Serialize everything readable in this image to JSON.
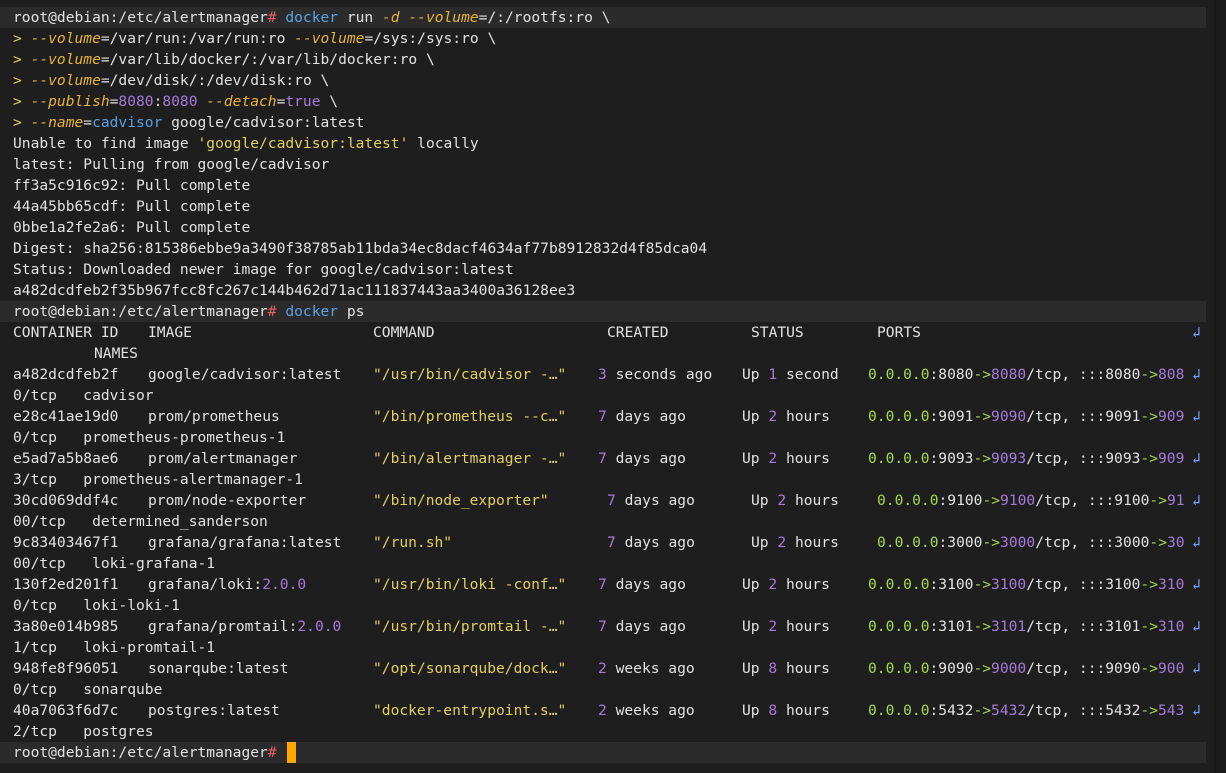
{
  "terminal": {
    "lines": [
      {
        "prompt": true,
        "segs": [
          [
            "root@debian:/etc/alertmanager",
            "white"
          ],
          [
            "# ",
            "red"
          ],
          [
            "docker",
            "cmd"
          ],
          [
            " run ",
            "white"
          ],
          [
            "-d",
            "param"
          ],
          [
            " ",
            "white"
          ],
          [
            "--volume",
            "param"
          ],
          [
            "=/:/rootfs:ro \\",
            "white"
          ]
        ]
      },
      {
        "segs": [
          [
            "> ",
            "cont"
          ],
          [
            "--volume",
            "param"
          ],
          [
            "=/var/run:/var/run:ro ",
            "white"
          ],
          [
            "--volume",
            "param"
          ],
          [
            "=/sys:/sys:ro \\",
            "white"
          ]
        ]
      },
      {
        "segs": [
          [
            "> ",
            "cont"
          ],
          [
            "--volume",
            "param"
          ],
          [
            "=/var/lib/docker/:/var/lib/docker:ro \\",
            "white"
          ]
        ]
      },
      {
        "segs": [
          [
            "> ",
            "cont"
          ],
          [
            "--volume",
            "param"
          ],
          [
            "=/dev/disk/:/dev/disk:ro \\",
            "white"
          ]
        ]
      },
      {
        "segs": [
          [
            "> ",
            "cont"
          ],
          [
            "--publish",
            "param"
          ],
          [
            "=",
            "white"
          ],
          [
            "8080",
            "num"
          ],
          [
            ":",
            "white"
          ],
          [
            "8080",
            "num"
          ],
          [
            " ",
            "white"
          ],
          [
            "--detach",
            "param"
          ],
          [
            "=",
            "white"
          ],
          [
            "true",
            "bool"
          ],
          [
            " \\",
            "white"
          ]
        ]
      },
      {
        "segs": [
          [
            "> ",
            "cont"
          ],
          [
            "--name",
            "param"
          ],
          [
            "=",
            "white"
          ],
          [
            "cadvisor",
            "cmd"
          ],
          [
            " google/cadvisor:latest",
            "white"
          ]
        ]
      },
      {
        "segs": [
          [
            "Unable to find image ",
            "white"
          ],
          [
            "'google/cadvisor:latest'",
            "str"
          ],
          [
            " locally",
            "white"
          ]
        ]
      },
      {
        "segs": [
          [
            "latest: Pulling from google/cadvisor",
            "white"
          ]
        ]
      },
      {
        "segs": [
          [
            "ff3a5c916c92: Pull complete",
            "white"
          ]
        ]
      },
      {
        "segs": [
          [
            "44a45bb65cdf: Pull complete",
            "white"
          ]
        ]
      },
      {
        "segs": [
          [
            "0bbe1a2fe2a6: Pull complete",
            "white"
          ]
        ]
      },
      {
        "segs": [
          [
            "Digest: sha256:815386ebbe9a3490f38785ab11bda34ec8dacf4634af77b8912832d4f85dca04",
            "white"
          ]
        ]
      },
      {
        "segs": [
          [
            "Status: Downloaded newer image for google/cadvisor:latest",
            "white"
          ]
        ]
      },
      {
        "segs": [
          [
            "a482dcdfeb2f35b967fcc8fc267c144b462d71ac111837443aa3400a36128ee3",
            "white"
          ]
        ]
      },
      {
        "prompt": true,
        "segs": [
          [
            "root@debian:/etc/alertmanager",
            "white"
          ],
          [
            "# ",
            "red"
          ],
          [
            "docker",
            "cmd"
          ],
          [
            " ps",
            "white"
          ]
        ]
      },
      {
        "cols": [
          [
            "CONTAINER ID",
            13,
            "white"
          ],
          [
            "IMAGE",
            148,
            "white"
          ],
          [
            "COMMAND",
            373,
            "white"
          ],
          [
            "CREATED",
            607,
            "white"
          ],
          [
            "STATUS",
            751,
            "white"
          ],
          [
            "PORTS",
            877,
            "white"
          ],
          [
            "↲",
            1192,
            "wrap"
          ]
        ]
      },
      {
        "cols": [
          [
            "NAMES",
            94,
            "white"
          ]
        ]
      },
      {
        "cols": [
          [
            "a482dcdfeb2f",
            13,
            "white"
          ],
          [
            "google/cadvisor:latest",
            148,
            "white"
          ],
          [
            "\"/usr/bin/cadvisor -…\"",
            373,
            "str"
          ],
          [
            "3 seconds ago",
            598,
            "white"
          ],
          [
            "Up 1 second",
            742,
            "white"
          ],
          [
            "0.0.0.0:8080->8080/tcp, :::8080->808",
            868,
            "green"
          ],
          [
            "↲",
            1192,
            "wrap"
          ]
        ]
      },
      {
        "cols": [
          [
            "0/tcp   cadvisor",
            13,
            "white"
          ]
        ]
      },
      {
        "cols": [
          [
            "e28c41ae19d0",
            13,
            "white"
          ],
          [
            "prom/prometheus",
            148,
            "white"
          ],
          [
            "\"/bin/prometheus --c…\"",
            373,
            "str"
          ],
          [
            "7 days ago",
            598,
            "white"
          ],
          [
            "Up 2 hours",
            742,
            "white"
          ],
          [
            "0.0.0.0:9091->9090/tcp, :::9091->909",
            868,
            "green"
          ],
          [
            "↲",
            1192,
            "wrap"
          ]
        ]
      },
      {
        "cols": [
          [
            "0/tcp   prometheus-prometheus-1",
            13,
            "white"
          ]
        ]
      },
      {
        "cols": [
          [
            "e5ad7a5b8ae6",
            13,
            "white"
          ],
          [
            "prom/alertmanager",
            148,
            "white"
          ],
          [
            "\"/bin/alertmanager -…\"",
            373,
            "str"
          ],
          [
            "7 days ago",
            598,
            "white"
          ],
          [
            "Up 2 hours",
            742,
            "white"
          ],
          [
            "0.0.0.0:9093->9093/tcp, :::9093->909",
            868,
            "green"
          ],
          [
            "↲",
            1192,
            "wrap"
          ]
        ]
      },
      {
        "cols": [
          [
            "3/tcp   prometheus-alertmanager-1",
            13,
            "white"
          ]
        ]
      },
      {
        "cols": [
          [
            "30cd069ddf4c",
            13,
            "white"
          ],
          [
            "prom/node-exporter",
            148,
            "white"
          ],
          [
            "\"/bin/node_exporter\"",
            373,
            "str"
          ],
          [
            "7 days ago",
            607,
            "white"
          ],
          [
            "Up 2 hours",
            751,
            "white"
          ],
          [
            "0.0.0.0:9100->9100/tcp, :::9100->91",
            877,
            "green"
          ],
          [
            "↲",
            1192,
            "wrap"
          ]
        ]
      },
      {
        "cols": [
          [
            "00/tcp   determined_sanderson",
            13,
            "white"
          ]
        ]
      },
      {
        "cols": [
          [
            "9c83403467f1",
            13,
            "white"
          ],
          [
            "grafana/grafana:latest",
            148,
            "white"
          ],
          [
            "\"/run.sh\"",
            373,
            "str"
          ],
          [
            "7 days ago",
            607,
            "white"
          ],
          [
            "Up 2 hours",
            751,
            "white"
          ],
          [
            "0.0.0.0:3000->3000/tcp, :::3000->30",
            877,
            "green"
          ],
          [
            "↲",
            1192,
            "wrap"
          ]
        ]
      },
      {
        "cols": [
          [
            "00/tcp   loki-grafana-1",
            13,
            "white"
          ]
        ]
      },
      {
        "cols": [
          [
            "130f2ed201f1",
            13,
            "white"
          ],
          [
            "grafana/loki:2.0.0",
            148,
            "white"
          ],
          [
            "\"/usr/bin/loki -conf…\"",
            373,
            "str"
          ],
          [
            "7 days ago",
            598,
            "white"
          ],
          [
            "Up 2 hours",
            742,
            "white"
          ],
          [
            "0.0.0.0:3100->3100/tcp, :::3100->310",
            868,
            "green"
          ],
          [
            "↲",
            1192,
            "wrap"
          ]
        ]
      },
      {
        "cols": [
          [
            "0/tcp   loki-loki-1",
            13,
            "white"
          ]
        ]
      },
      {
        "cols": [
          [
            "3a80e014b985",
            13,
            "white"
          ],
          [
            "grafana/promtail:2.0.0",
            148,
            "white"
          ],
          [
            "\"/usr/bin/promtail -…\"",
            373,
            "str"
          ],
          [
            "7 days ago",
            598,
            "white"
          ],
          [
            "Up 2 hours",
            742,
            "white"
          ],
          [
            "0.0.0.0:3101->3101/tcp, :::3101->310",
            868,
            "green"
          ],
          [
            "↲",
            1192,
            "wrap"
          ]
        ]
      },
      {
        "cols": [
          [
            "1/tcp   loki-promtail-1",
            13,
            "white"
          ]
        ]
      },
      {
        "cols": [
          [
            "948fe8f96051",
            13,
            "white"
          ],
          [
            "sonarqube:latest",
            148,
            "white"
          ],
          [
            "\"/opt/sonarqube/dock…\"",
            373,
            "str"
          ],
          [
            "2 weeks ago",
            598,
            "white"
          ],
          [
            "Up 8 hours",
            742,
            "white"
          ],
          [
            "0.0.0.0:9090->9000/tcp, :::9090->900",
            868,
            "green"
          ],
          [
            "↲",
            1192,
            "wrap"
          ]
        ]
      },
      {
        "cols": [
          [
            "0/tcp   sonarqube",
            13,
            "white"
          ]
        ]
      },
      {
        "cols": [
          [
            "40a7063f6d7c",
            13,
            "white"
          ],
          [
            "postgres:latest",
            148,
            "white"
          ],
          [
            "\"docker-entrypoint.s…\"",
            373,
            "str"
          ],
          [
            "2 weeks ago",
            598,
            "white"
          ],
          [
            "Up 8 hours",
            742,
            "white"
          ],
          [
            "0.0.0.0:5432->5432/tcp, :::5432->543",
            868,
            "green"
          ],
          [
            "↲",
            1192,
            "wrap"
          ]
        ]
      },
      {
        "cols": [
          [
            "2/tcp   postgres",
            13,
            "white"
          ]
        ]
      },
      {
        "prompt": true,
        "cursor": true,
        "segs": [
          [
            "root@debian:/etc/alertmanager",
            "white"
          ],
          [
            "# ",
            "red"
          ]
        ]
      }
    ]
  }
}
